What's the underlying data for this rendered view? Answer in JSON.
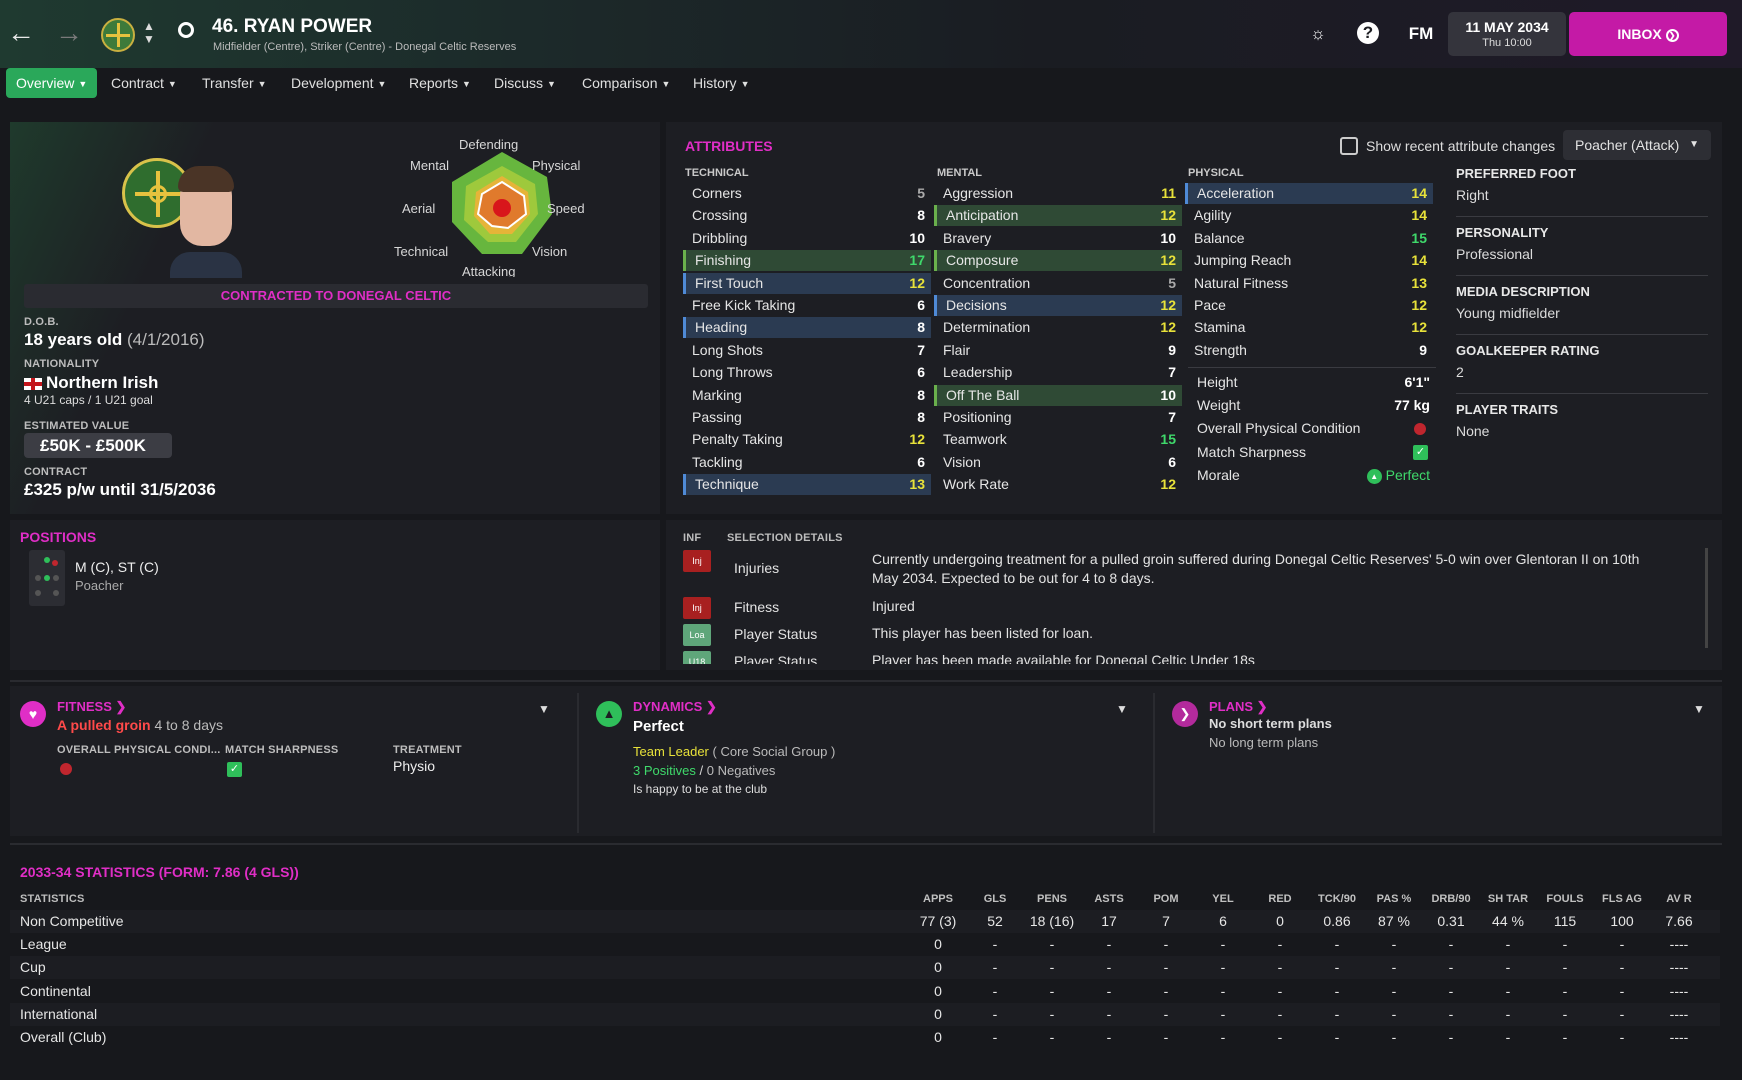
{
  "header": {
    "number_name": "46. RYAN POWER",
    "subtitle": "Midfielder (Centre), Striker (Centre) - Donegal Celtic Reserves",
    "date": "11 MAY 2034",
    "time": "Thu 10:00",
    "inbox": "INBOX",
    "fm": "FM"
  },
  "tabs": [
    "Overview",
    "Contract",
    "Transfer",
    "Development",
    "Reports",
    "Discuss",
    "Comparison",
    "History"
  ],
  "radar": {
    "labels": {
      "top": "Defending",
      "top_left": "Mental",
      "top_right": "Physical",
      "left": "Aerial",
      "right": "Speed",
      "bottom_left": "Technical",
      "bottom_right": "Vision",
      "bottom": "Attacking"
    }
  },
  "profile": {
    "contract_banner": "CONTRACTED TO DONEGAL CELTIC",
    "dob_label": "D.O.B.",
    "age": "18 years old",
    "dob": "(4/1/2016)",
    "nationality_label": "NATIONALITY",
    "nationality": "Northern Irish",
    "caps": "4 U21 caps / 1 U21 goal",
    "value_label": "ESTIMATED VALUE",
    "value": "£50K - £500K",
    "contract_label": "CONTRACT",
    "contract": "£325 p/w until 31/5/2036"
  },
  "attributes": {
    "title": "ATTRIBUTES",
    "show_changes": "Show recent attribute changes",
    "role": "Poacher (Attack)",
    "technical_label": "TECHNICAL",
    "mental_label": "MENTAL",
    "physical_label": "PHYSICAL",
    "technical": [
      [
        "Corners",
        "5",
        ""
      ],
      [
        "Crossing",
        "8",
        ""
      ],
      [
        "Dribbling",
        "10",
        ""
      ],
      [
        "Finishing",
        "17",
        "green"
      ],
      [
        "First Touch",
        "12",
        "blue"
      ],
      [
        "Free Kick Taking",
        "6",
        ""
      ],
      [
        "Heading",
        "8",
        "blue"
      ],
      [
        "Long Shots",
        "7",
        ""
      ],
      [
        "Long Throws",
        "6",
        ""
      ],
      [
        "Marking",
        "8",
        ""
      ],
      [
        "Passing",
        "8",
        ""
      ],
      [
        "Penalty Taking",
        "12",
        ""
      ],
      [
        "Tackling",
        "6",
        ""
      ],
      [
        "Technique",
        "13",
        "blue"
      ]
    ],
    "mental": [
      [
        "Aggression",
        "11",
        ""
      ],
      [
        "Anticipation",
        "12",
        "green"
      ],
      [
        "Bravery",
        "10",
        ""
      ],
      [
        "Composure",
        "12",
        "green"
      ],
      [
        "Concentration",
        "5",
        ""
      ],
      [
        "Decisions",
        "12",
        "blue"
      ],
      [
        "Determination",
        "12",
        ""
      ],
      [
        "Flair",
        "9",
        ""
      ],
      [
        "Leadership",
        "7",
        ""
      ],
      [
        "Off The Ball",
        "10",
        "green"
      ],
      [
        "Positioning",
        "7",
        ""
      ],
      [
        "Teamwork",
        "15",
        ""
      ],
      [
        "Vision",
        "6",
        ""
      ],
      [
        "Work Rate",
        "12",
        ""
      ]
    ],
    "physical": [
      [
        "Acceleration",
        "14",
        "blue"
      ],
      [
        "Agility",
        "14",
        ""
      ],
      [
        "Balance",
        "15",
        ""
      ],
      [
        "Jumping Reach",
        "14",
        ""
      ],
      [
        "Natural Fitness",
        "13",
        ""
      ],
      [
        "Pace",
        "12",
        ""
      ],
      [
        "Stamina",
        "12",
        ""
      ],
      [
        "Strength",
        "9",
        ""
      ]
    ],
    "extra": {
      "height_label": "Height",
      "height": "6'1\"",
      "weight_label": "Weight",
      "weight": "77 kg",
      "opc_label": "Overall Physical Condition",
      "ms_label": "Match Sharpness",
      "morale_label": "Morale",
      "morale": "Perfect"
    }
  },
  "info": {
    "foot_label": "PREFERRED FOOT",
    "foot": "Right",
    "personality_label": "PERSONALITY",
    "personality": "Professional",
    "media_label": "MEDIA DESCRIPTION",
    "media": "Young midfielder",
    "gk_label": "GOALKEEPER RATING",
    "gk": "2",
    "traits_label": "PLAYER TRAITS",
    "traits": "None"
  },
  "positions": {
    "title": "POSITIONS",
    "pos": "M (C), ST (C)",
    "role": "Poacher"
  },
  "selection": {
    "inf_label": "INF",
    "details_label": "SELECTION DETAILS",
    "rows": [
      {
        "badge": "Inj",
        "badge_color": "#a82020",
        "name": "Injuries",
        "text": "Currently undergoing treatment for a pulled groin suffered during Donegal Celtic Reserves' 5-0 win over Glentoran II on 10th May 2034. Expected to be out for 4 to 8 days."
      },
      {
        "badge": "Inj",
        "badge_color": "#a82020",
        "name": "Fitness",
        "text": "Injured"
      },
      {
        "badge": "Loa",
        "badge_color": "#5fa67a",
        "name": "Player Status",
        "text": "This player has been listed for loan."
      },
      {
        "badge": "U18",
        "badge_color": "#5fa67a",
        "name": "Player Status",
        "text": "Player has been made available for Donegal Celtic Under 18s"
      }
    ]
  },
  "fitness": {
    "title": "FITNESS",
    "injury": "A pulled groin",
    "duration": "4 to 8 days",
    "opc_label": "OVERALL PHYSICAL CONDI...",
    "ms_label": "MATCH SHARPNESS",
    "treat_label": "TREATMENT",
    "treatment": "Physio"
  },
  "dynamics": {
    "title": "DYNAMICS",
    "status": "Perfect",
    "leader": "Team Leader",
    "group": "( Core Social Group )",
    "positives": "3 Positives",
    "sep": "/",
    "negatives": "0 Negatives",
    "happy": "Is happy to be at the club"
  },
  "plans": {
    "title": "PLANS",
    "short": "No short term plans",
    "long": "No long term plans"
  },
  "stats": {
    "title": "2033-34 STATISTICS (FORM: 7.86 (4 GLS))",
    "row_label": "STATISTICS",
    "headers": [
      "APPS",
      "GLS",
      "PENS",
      "ASTS",
      "POM",
      "YEL",
      "RED",
      "TCK/90",
      "PAS %",
      "DRB/90",
      "SH TAR",
      "FOULS",
      "FLS AG",
      "AV R"
    ],
    "rows": [
      {
        "name": "Non Competitive",
        "vals": [
          "77 (3)",
          "52",
          "18 (16)",
          "17",
          "7",
          "6",
          "0",
          "0.86",
          "87 %",
          "0.31",
          "44 %",
          "115",
          "100",
          "7.66"
        ]
      },
      {
        "name": "League",
        "vals": [
          "0",
          "-",
          "-",
          "-",
          "-",
          "-",
          "-",
          "-",
          "-",
          "-",
          "-",
          "-",
          "-",
          "----"
        ]
      },
      {
        "name": "Cup",
        "vals": [
          "0",
          "-",
          "-",
          "-",
          "-",
          "-",
          "-",
          "-",
          "-",
          "-",
          "-",
          "-",
          "-",
          "----"
        ]
      },
      {
        "name": "Continental",
        "vals": [
          "0",
          "-",
          "-",
          "-",
          "-",
          "-",
          "-",
          "-",
          "-",
          "-",
          "-",
          "-",
          "-",
          "----"
        ]
      },
      {
        "name": "International",
        "vals": [
          "0",
          "-",
          "-",
          "-",
          "-",
          "-",
          "-",
          "-",
          "-",
          "-",
          "-",
          "-",
          "-",
          "----"
        ]
      },
      {
        "name": "Overall (Club)",
        "vals": [
          "0",
          "-",
          "-",
          "-",
          "-",
          "-",
          "-",
          "-",
          "-",
          "-",
          "-",
          "-",
          "-",
          "----"
        ]
      }
    ]
  },
  "colors": {
    "accent": "#e02ec6",
    "green": "#2aa85a",
    "yellow": "#e8e23a",
    "inbox": "#c41aa6"
  }
}
